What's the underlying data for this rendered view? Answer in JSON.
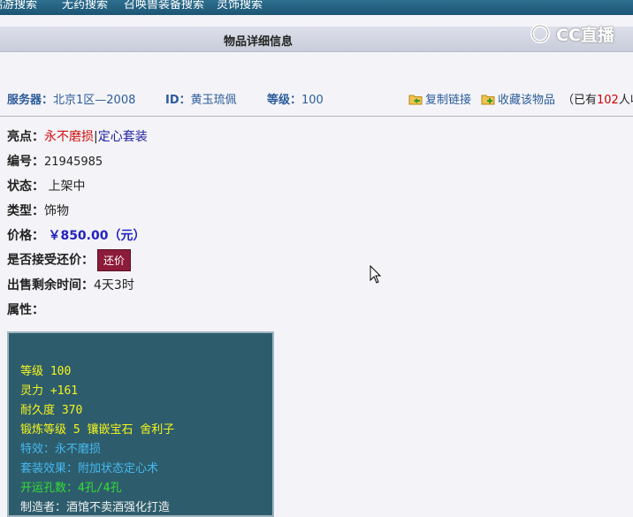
{
  "topnav": {
    "items": [
      "端游搜索",
      "无药搜索",
      "召唤兽装备搜索",
      "灵饰搜索"
    ]
  },
  "titlebar": {
    "title": "物品详细信息",
    "logo_text": "CC直播"
  },
  "info": {
    "server_label": "服务器：",
    "server_value": "北京1区—2008",
    "id_label": "ID：",
    "id_value": "黄玉琉佩",
    "level_label": "等级：",
    "level_value": "100",
    "copy_link": "复制链接",
    "favorite": "收藏该物品",
    "collect_prefix": "（已有",
    "collect_count": "102",
    "collect_suffix": "人收藏"
  },
  "details": {
    "highlight_label": "亮点：",
    "highlight_1": "永不磨损",
    "highlight_sep": "|",
    "highlight_2": "定心套装",
    "number_label": "编号：",
    "number_value": "21945985",
    "status_label": "状态：",
    "status_value": "上架中",
    "type_label": "类型：",
    "type_value": "饰物",
    "price_label": "价格：",
    "price_value": "￥850.00（元）",
    "bargain_label": "是否接受还价：",
    "bargain_button": "还价",
    "remaining_label": "出售剩余时间：",
    "remaining_value": "4天3时",
    "attr_label": "属性："
  },
  "attributes": {
    "level": "等级 100",
    "spirit": "灵力 +161",
    "durability": "耐久度 370",
    "forge": "锻炼等级 5 镶嵌宝石 舍利子",
    "effect": "特效：永不磨损",
    "set_effect": "套装效果：附加状态定心术",
    "holes": "开运孔数：4孔/4孔",
    "maker": "制造者：酒馆不卖酒强化打造"
  },
  "colors": {
    "nav_bg": "#1d5574",
    "attr_box_bg": "#2d5d6c",
    "bargain_btn": "#8d1b3a",
    "link_blue": "#2b5b9a"
  }
}
